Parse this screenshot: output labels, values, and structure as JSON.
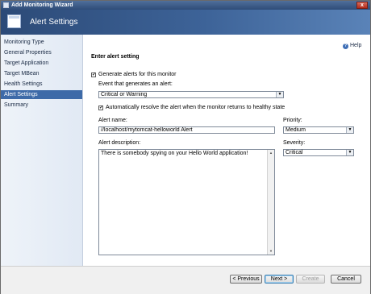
{
  "window": {
    "title": "Add Monitoring Wizard",
    "close_glyph": "x"
  },
  "banner": {
    "title": "Alert Settings",
    "icon": "wizard-page-icon"
  },
  "sidebar": {
    "items": [
      {
        "label": "Monitoring Type",
        "active": false
      },
      {
        "label": "General Properties",
        "active": false
      },
      {
        "label": "Target Application",
        "active": false
      },
      {
        "label": "Target MBean",
        "active": false
      },
      {
        "label": "Health Settings",
        "active": false
      },
      {
        "label": "Alert Settings",
        "active": true
      },
      {
        "label": "Summary",
        "active": false
      }
    ]
  },
  "help": {
    "label": "Help",
    "icon": "help-icon"
  },
  "form": {
    "heading": "Enter alert setting",
    "generate_alerts": {
      "label": "Generate alerts for this monitor",
      "checked": true
    },
    "event_label": "Event that generates an alert:",
    "event_value": "Critical or Warning",
    "auto_resolve": {
      "label": "Automatically resolve the alert when the monitor returns to healthy state",
      "checked": true
    },
    "alert_name_label": "Alert name:",
    "alert_name_value": "//localhost/mytomcat-helloworld Alert",
    "priority_label": "Priority:",
    "priority_value": "Medium",
    "description_label": "Alert description:",
    "description_value": "There is somebody spying on your Hello World application!",
    "severity_label": "Severity:",
    "severity_value": "Critical"
  },
  "footer": {
    "previous": "< Previous",
    "next": "Next >",
    "create": "Create",
    "cancel": "Cancel"
  },
  "colors": {
    "banner": "#3d6398",
    "active_nav": "#3d6aa8",
    "sidebar": "#e8eef7"
  }
}
